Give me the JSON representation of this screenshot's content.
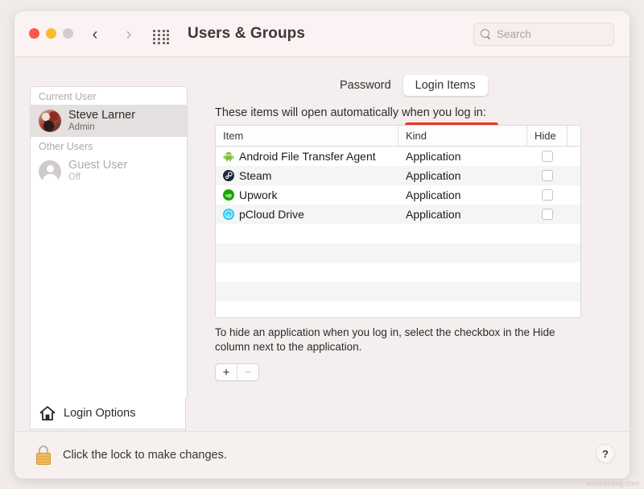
{
  "window": {
    "title": "Users & Groups",
    "traffic_lights": [
      "close",
      "minimize",
      "zoom"
    ],
    "nav": {
      "back": "‹",
      "forward": "›"
    },
    "grid_icon": "show-all-icon"
  },
  "search": {
    "placeholder": "Search",
    "value": "",
    "icon": "search-icon"
  },
  "sidebar": {
    "groups": [
      {
        "header": "Current User",
        "users": [
          {
            "name": "Steve Larner",
            "status": "Admin",
            "selected": true,
            "avatar": "user-photo"
          }
        ]
      },
      {
        "header": "Other Users",
        "users": [
          {
            "name": "Guest User",
            "status": "Off",
            "selected": false,
            "avatar": "guest-silhouette"
          }
        ]
      }
    ],
    "login_options": {
      "label": "Login Options",
      "icon": "home-icon"
    },
    "footer": {
      "add": "+",
      "remove": "−",
      "enabled": false
    }
  },
  "tabs": [
    {
      "label": "Password",
      "active": false
    },
    {
      "label": "Login Items",
      "active": true,
      "highlighted": true
    }
  ],
  "main": {
    "intro": "These items will open automatically when you log in:",
    "columns": [
      "Item",
      "Kind",
      "Hide"
    ],
    "rows": [
      {
        "item": "Android File Transfer Agent",
        "kind": "Application",
        "hide": false,
        "icon": "android-icon"
      },
      {
        "item": "Steam",
        "kind": "Application",
        "hide": false,
        "icon": "steam-icon"
      },
      {
        "item": "Upwork",
        "kind": "Application",
        "hide": false,
        "icon": "upwork-icon"
      },
      {
        "item": "pCloud Drive",
        "kind": "Application",
        "hide": false,
        "icon": "pcloud-icon"
      }
    ],
    "empty_rows": 6,
    "note": "To hide an application when you log in, select the checkbox in the Hide column next to the application.",
    "add_button": "+",
    "remove_button": "−"
  },
  "footer": {
    "lock_text": "Click the lock to make changes.",
    "lock_icon": "locked-padlock-icon",
    "help": "?"
  },
  "watermark": "www.4eaag.com",
  "colors": {
    "accent_red": "#ec3523",
    "titlebar": "#fbf3f3",
    "window_bg": "#f4efee",
    "selection": "#e3e0df"
  }
}
